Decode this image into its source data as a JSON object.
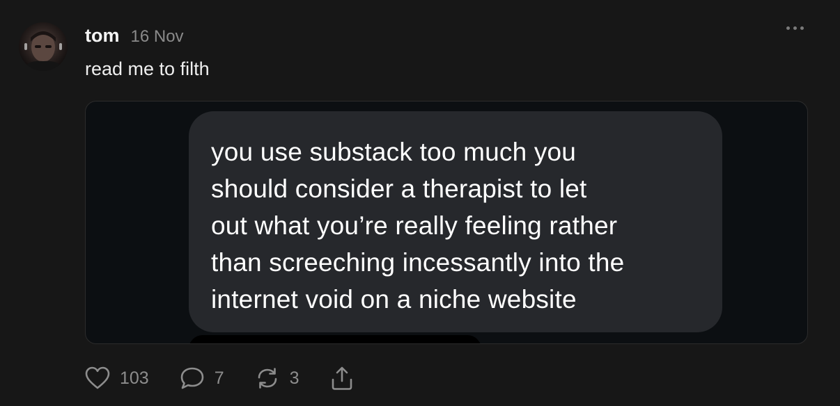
{
  "post": {
    "author": "tom",
    "date": "16 Nov",
    "text": "read me to filth",
    "embed": {
      "message_lines": [
        "you use substack too much you",
        "should consider a therapist to let",
        "out what you’re really feeling rather",
        "than screeching incessantly into the",
        "internet void on a niche website"
      ]
    },
    "stats": {
      "likes": "103",
      "comments": "7",
      "restacks": "3"
    }
  },
  "icons": {
    "avatar": "profile-photo",
    "more": "more-dots-icon",
    "like": "heart-icon",
    "comment": "comment-bubble-icon",
    "restack": "restack-icon",
    "share": "share-icon"
  },
  "colors": {
    "background": "#171717",
    "embed_background": "#0c0f12",
    "bubble": "#26282c",
    "muted_text": "#8a8a8a"
  }
}
